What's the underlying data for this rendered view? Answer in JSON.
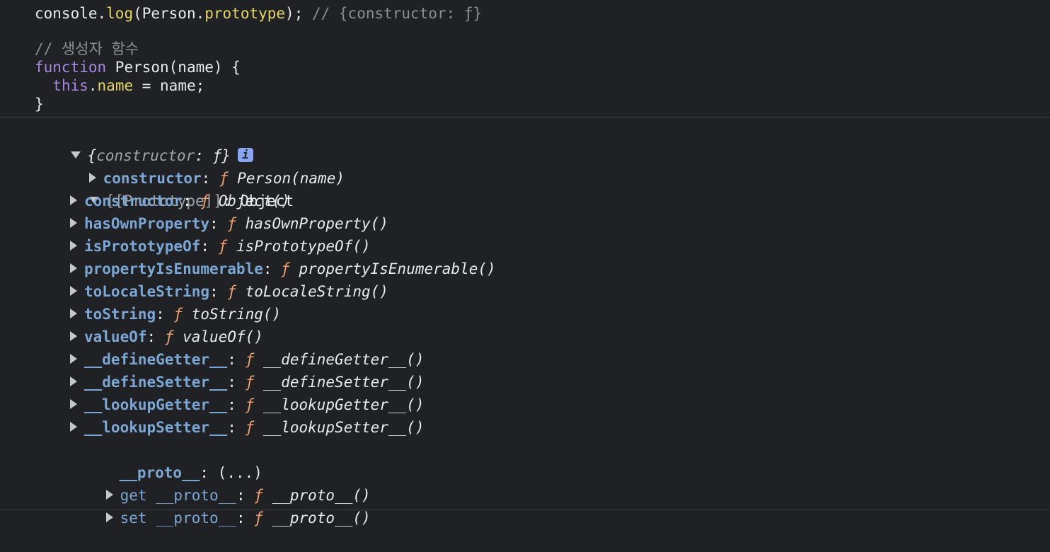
{
  "code": {
    "line_log_prefix": "console.",
    "line_log_fn": "log",
    "line_log_open": "(Person.",
    "line_log_prop": "prototype",
    "line_log_close": "); ",
    "line_log_comment": "// {constructor: ƒ}",
    "comment_ctor": "// 생성자 함수",
    "kw_function": "function",
    "fn_sig": " Person(name) {",
    "kw_this": "this",
    "dot": ".",
    "this_prop": "name",
    "assign": " = name;",
    "close_brace": "}"
  },
  "tree": {
    "summary_open": "{",
    "summary_key": "constructor",
    "summary_rest": ": ƒ}",
    "info_badge": "i",
    "f_glyph": "ƒ",
    "colon": ": ",
    "ctor_key": "constructor",
    "ctor_val": "Person(name)",
    "proto_label": "[[Prototype]]",
    "proto_value": "Object",
    "items": [
      {
        "key": "constructor",
        "val": "Object()"
      },
      {
        "key": "hasOwnProperty",
        "val": "hasOwnProperty()"
      },
      {
        "key": "isPrototypeOf",
        "val": "isPrototypeOf()"
      },
      {
        "key": "propertyIsEnumerable",
        "val": "propertyIsEnumerable()"
      },
      {
        "key": "toLocaleString",
        "val": "toLocaleString()"
      },
      {
        "key": "toString",
        "val": "toString()"
      },
      {
        "key": "valueOf",
        "val": "valueOf()"
      },
      {
        "key": "__defineGetter__",
        "val": "__defineGetter__()"
      },
      {
        "key": "__defineSetter__",
        "val": "__defineSetter__()"
      },
      {
        "key": "__lookupGetter__",
        "val": "__lookupGetter__()"
      },
      {
        "key": "__lookupSetter__",
        "val": "__lookupSetter__()"
      }
    ],
    "proto_accessor_key": "__proto__",
    "proto_accessor_val": "(...)",
    "getter_label": "get __proto__",
    "setter_label": "set __proto__",
    "getter_val": "__proto__()",
    "setter_val": "__proto__()"
  }
}
